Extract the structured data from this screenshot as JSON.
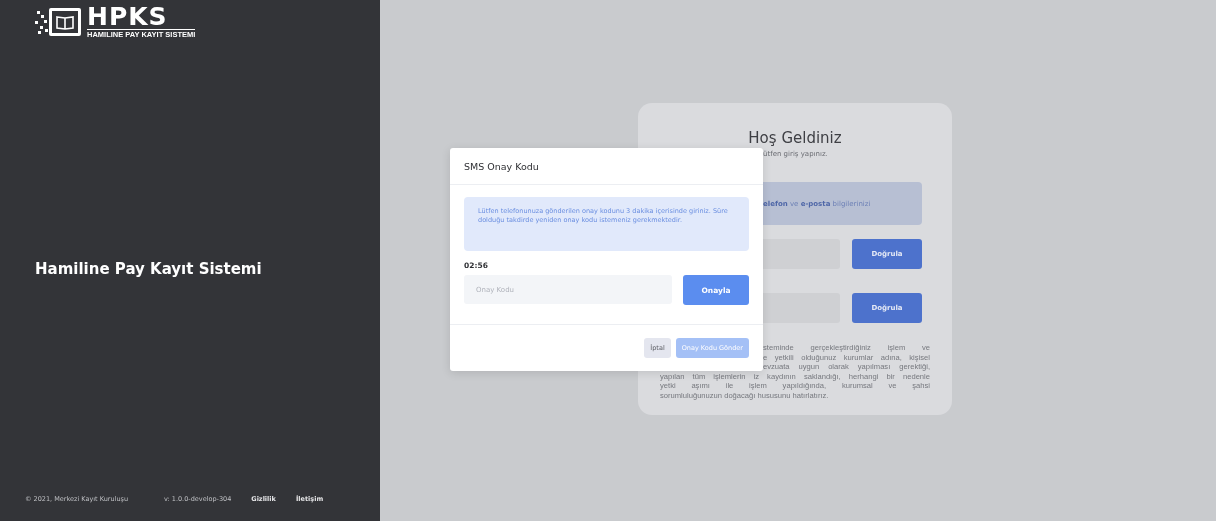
{
  "brand": {
    "logo_text": "HPKS",
    "logo_subtitle": "HAMILINE PAY KAYIT SISTEMI",
    "title": "Hamiline Pay Kayıt Sistemi"
  },
  "footer": {
    "copyright": "© 2021, Merkezi Kayıt Kuruluşu",
    "version": "v: 1.0.0-develop-304",
    "links": [
      "Gizlilik",
      "İletişim"
    ]
  },
  "login_card": {
    "title": "Hoş Geldiniz",
    "subtitle_fragment": "ütfen giriş yapınız.",
    "info_fragment": "**elefon** ve **e-posta** bilgilerinizi",
    "verify_buttons": [
      "Doğrula",
      "Doğrula"
    ],
    "notice_fragments": [
      "steminde gerçekleştirdiğiniz işlem ve",
      "e yetkili olduğunuz kurumlar adına, kişisel",
      "evzuata uygun olarak yapılması gerektiği,"
    ],
    "notice_lines": [
      "yapılan tüm işlemlerin iz kaydının saklandığı, herhangi bir nedenle",
      "yetki aşımı ile işlem yapıldığında, kurumsal ve şahsi",
      "sorumluluğunuzun doğacağı hususunu hatırlatırız."
    ]
  },
  "dialog": {
    "title": "SMS Onay Kodu",
    "message": "Lütfen telefonunuza gönderilen onay kodunu 3 dakika içerisinde giriniz. Süre dolduğu takdirde yeniden onay kodu istemeniz gerekmektedir.",
    "timer": "02:56",
    "code_field": {
      "placeholder": "Onay Kodu"
    },
    "confirm_button": "Onayla",
    "footer_buttons": [
      {
        "label": "İptal",
        "kind": "secondary",
        "disabled": false
      },
      {
        "label": "Onay Kodu Gönder",
        "kind": "primary",
        "disabled": true
      }
    ]
  }
}
